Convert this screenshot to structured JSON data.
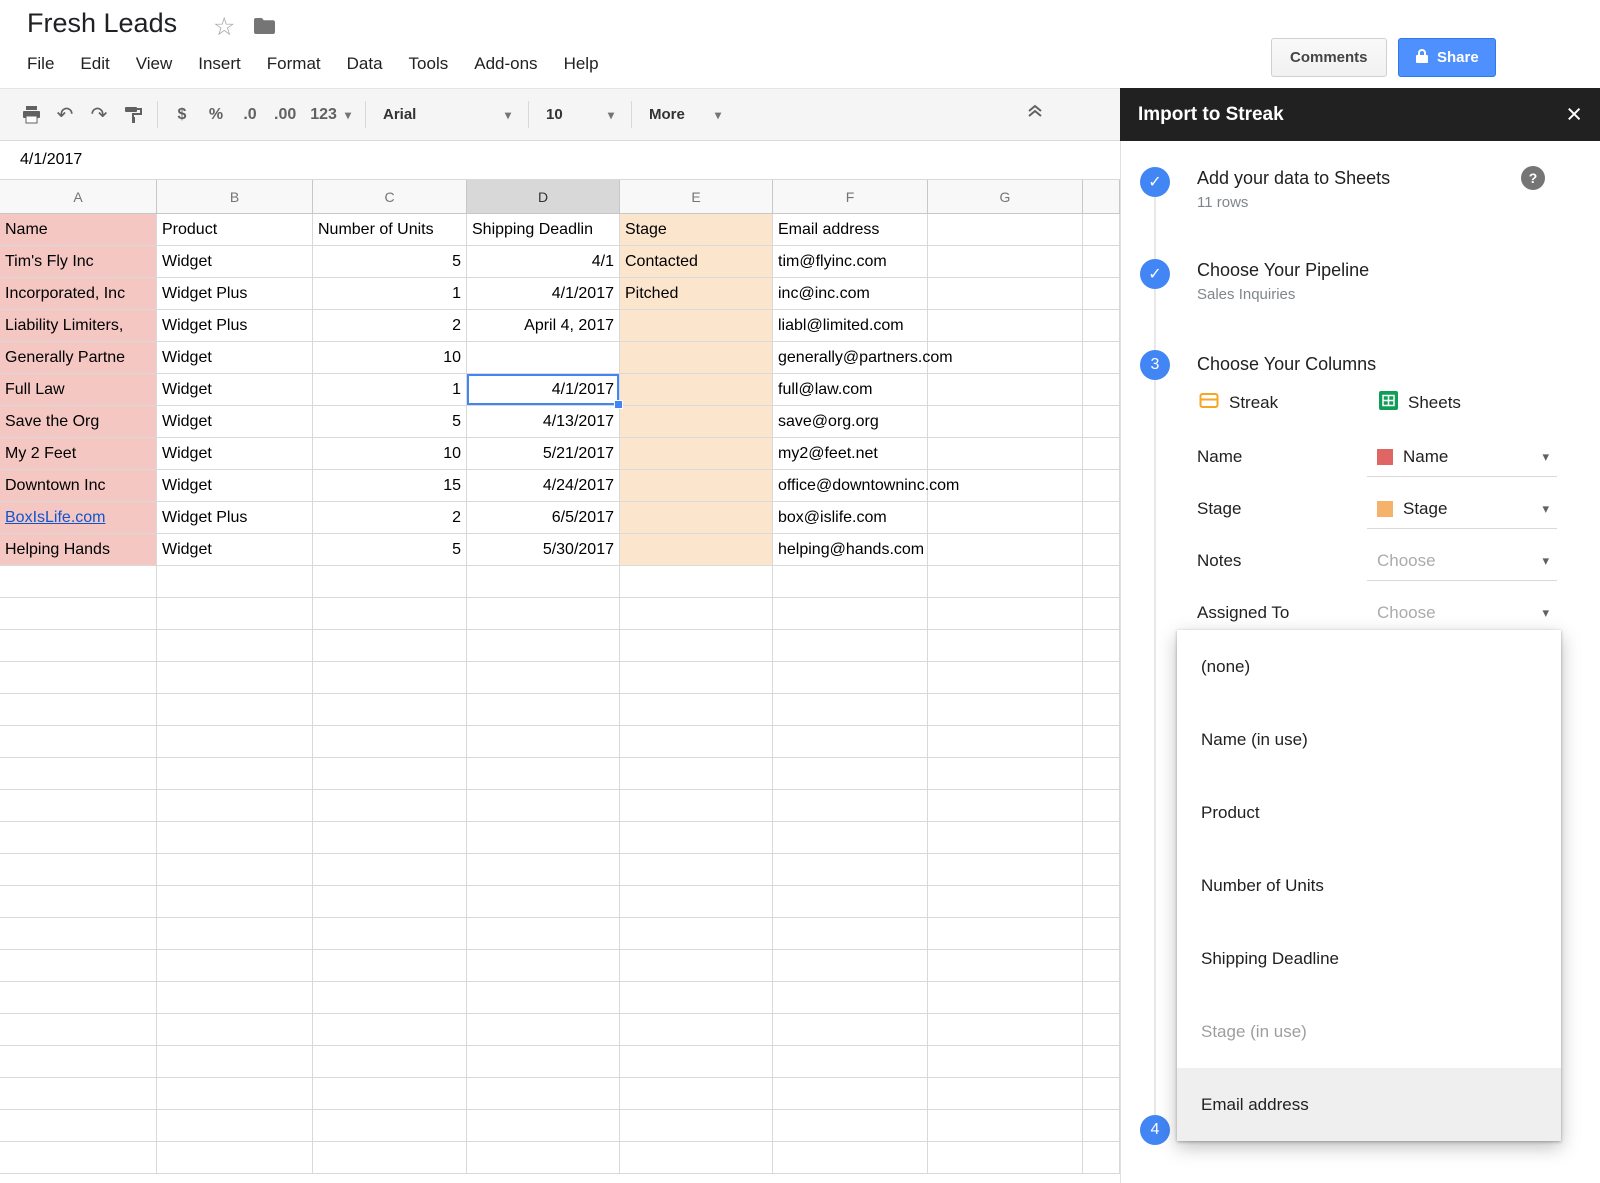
{
  "app": {
    "title": "Fresh Leads",
    "menus": [
      "File",
      "Edit",
      "View",
      "Insert",
      "Format",
      "Data",
      "Tools",
      "Add-ons",
      "Help"
    ],
    "buttons": {
      "comments": "Comments",
      "share": "Share"
    }
  },
  "icons": {
    "check": "✓",
    "close": "×",
    "caret_down": "▾",
    "star": "☆",
    "help": "?",
    "undo": "↶",
    "redo": "↷"
  },
  "toolbar": {
    "format_currency": "$",
    "format_percent": "%",
    "decrease_decimals": ".0",
    "increase_decimals": ".00",
    "more_formats": "123",
    "font_name": "Arial",
    "font_size": "10",
    "more_label": "More"
  },
  "formula_bar": {
    "value": "4/1/2017"
  },
  "sheet": {
    "column_letters": [
      "A",
      "B",
      "C",
      "D",
      "E",
      "F",
      "G"
    ],
    "header_row": [
      "Name",
      "Product",
      "Number of Units",
      "Shipping Deadlin",
      "Stage",
      "Email address",
      ""
    ],
    "rows": [
      [
        "Tim's Fly Inc",
        "Widget",
        "5",
        "4/1",
        "Contacted",
        "tim@flyinc.com",
        ""
      ],
      [
        "Incorporated, Inc",
        "Widget Plus",
        "1",
        "4/1/2017",
        "Pitched",
        "inc@inc.com",
        ""
      ],
      [
        "Liability Limiters,",
        "Widget Plus",
        "2",
        "April 4, 2017",
        "",
        "liabl@limited.com",
        ""
      ],
      [
        "Generally Partne",
        "Widget",
        "10",
        "",
        "",
        "generally@partners.com",
        ""
      ],
      [
        "Full Law",
        "Widget",
        "1",
        "4/1/2017",
        "",
        "full@law.com",
        ""
      ],
      [
        "Save the Org",
        "Widget",
        "5",
        "4/13/2017",
        "",
        "save@org.org",
        ""
      ],
      [
        "My 2 Feet",
        "Widget",
        "10",
        "5/21/2017",
        "",
        "my2@feet.net",
        ""
      ],
      [
        "Downtown Inc",
        "Widget",
        "15",
        "4/24/2017",
        "",
        "office@downtowninc.com",
        ""
      ],
      [
        "BoxIsLife.com",
        "Widget Plus",
        "2",
        "6/5/2017",
        "",
        "box@islife.com",
        ""
      ],
      [
        "Helping Hands",
        "Widget",
        "5",
        "5/30/2017",
        "",
        "helping@hands.com",
        ""
      ]
    ],
    "link_text": "BoxIsLife.com",
    "selected": {
      "row": 5,
      "col": 3
    },
    "colors": {
      "name_column": "#f4c7c3",
      "stage_column": "#fce5cd",
      "selection": "#4285f4",
      "link": "#1155cc"
    }
  },
  "sidebar": {
    "title": "Import to Streak",
    "steps": [
      {
        "marker": "check",
        "title": "Add your data to Sheets",
        "subtitle": "11 rows"
      },
      {
        "marker": "check",
        "title": "Choose Your Pipeline",
        "subtitle": "Sales Inquiries"
      },
      {
        "marker": "3",
        "title": "Choose Your Columns",
        "subtitle": ""
      },
      {
        "marker": "4",
        "title": "",
        "subtitle": ""
      }
    ],
    "columns_header": {
      "streak": "Streak",
      "sheets": "Sheets"
    },
    "mappings": [
      {
        "field": "Name",
        "value": "Name",
        "swatch": "#e06666",
        "placeholder": false
      },
      {
        "field": "Stage",
        "value": "Stage",
        "swatch": "#f6b26b",
        "placeholder": false
      },
      {
        "field": "Notes",
        "value": "Choose",
        "swatch": "",
        "placeholder": true
      },
      {
        "field": "Assigned To",
        "value": "Choose",
        "swatch": "",
        "placeholder": true
      }
    ],
    "dropdown_items": [
      {
        "label": "(none)",
        "state": "normal"
      },
      {
        "label": "Name (in use)",
        "state": "normal"
      },
      {
        "label": "Product",
        "state": "normal"
      },
      {
        "label": "Number of Units",
        "state": "normal"
      },
      {
        "label": "Shipping Deadline",
        "state": "normal"
      },
      {
        "label": "Stage (in use)",
        "state": "disabled"
      },
      {
        "label": "Email address",
        "state": "highlighted"
      }
    ]
  }
}
